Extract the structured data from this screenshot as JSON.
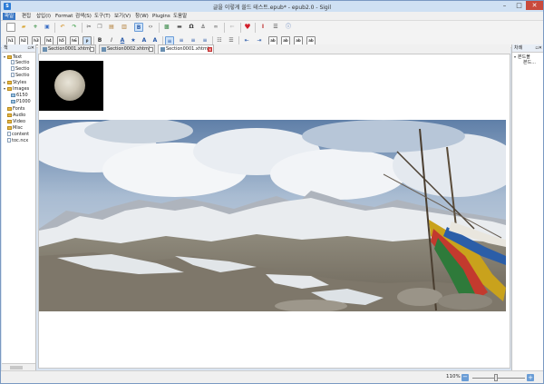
{
  "window": {
    "title": "글을 이렇게 쓸드 테스트.epub* - epub2.0 - Sigil",
    "app_icon": "sigil-app-icon",
    "controls": {
      "minimize": "–",
      "maximize": "□",
      "close": "✕"
    }
  },
  "menubar": {
    "items": [
      "파일",
      "편집",
      "삽입(I)",
      "Format",
      "검색(S)",
      "도구(T)",
      "보기(V)",
      "창(W)",
      "Plugins",
      "도움말"
    ]
  },
  "toolbar": {
    "row1_icons": [
      "new-file-icon",
      "open-icon",
      "add-icon",
      "save-icon",
      "undo-icon",
      "redo-icon",
      "cut-icon",
      "copy-icon",
      "paste-icon",
      "paste-special-icon",
      "book-view-icon",
      "code-view-icon",
      "insert-image-icon",
      "insert-special-char-icon",
      "insert-id-icon",
      "insert-link-icon",
      "remove-link-icon",
      "back-icon",
      "validate-icon",
      "metadata-icon",
      "table-of-contents-icon",
      "info-icon"
    ],
    "row2_heading_labels": [
      "h1",
      "h2",
      "h3",
      "h4",
      "h5",
      "h6",
      "p"
    ],
    "row2_format_labels": [
      "ab",
      "ab",
      "ab",
      "ab"
    ],
    "row2_icons": [
      "bold-icon",
      "italic-icon",
      "underline-icon",
      "strike-icon",
      "text-color-icon",
      "increase-font-icon",
      "superscript-icon",
      "align-left-icon",
      "align-center-icon",
      "align-right-icon",
      "justify-icon",
      "numbered-list-icon",
      "bulleted-list-icon",
      "outdent-icon",
      "indent-icon"
    ]
  },
  "book_browser": {
    "header": "책",
    "tree": [
      {
        "label": "Text",
        "kind": "folder",
        "level": 0,
        "expanded": true
      },
      {
        "label": "Sectio",
        "kind": "file",
        "level": 1
      },
      {
        "label": "Sectio",
        "kind": "file",
        "level": 1
      },
      {
        "label": "Sectio",
        "kind": "file",
        "level": 1
      },
      {
        "label": "Styles",
        "kind": "folder",
        "level": 0,
        "expanded": false
      },
      {
        "label": "Images",
        "kind": "folder",
        "level": 0,
        "expanded": true
      },
      {
        "label": "6150",
        "kind": "image",
        "level": 1
      },
      {
        "label": "P1000",
        "kind": "image",
        "level": 1
      },
      {
        "label": "Fonts",
        "kind": "folder",
        "level": 0,
        "expanded": false
      },
      {
        "label": "Audio",
        "kind": "folder",
        "level": 0,
        "expanded": false
      },
      {
        "label": "Video",
        "kind": "folder",
        "level": 0,
        "expanded": false
      },
      {
        "label": "Misc",
        "kind": "folder",
        "level": 0,
        "expanded": false
      },
      {
        "label": "content",
        "kind": "file",
        "level": 0
      },
      {
        "label": "toc.ncx",
        "kind": "file",
        "level": 0
      }
    ]
  },
  "tabs": [
    {
      "label": "Section0001.xhtml",
      "active": false
    },
    {
      "label": "Section0002.xhtml",
      "active": false
    },
    {
      "label": "Section0001.xhtml",
      "active": true
    }
  ],
  "toc_panel": {
    "header": "차례",
    "items": [
      {
        "label": "본드볼",
        "level": 0
      },
      {
        "label": "본드...",
        "level": 1
      }
    ]
  },
  "statusbar": {
    "zoom_level": "110%",
    "zoom_slider_fraction": 0.45,
    "zoom_out_label": "−",
    "zoom_in_label": "+"
  },
  "colors": {
    "accent": "#3a77c4",
    "close_button": "#c94a3c",
    "active_tab_close": "#e45050"
  }
}
